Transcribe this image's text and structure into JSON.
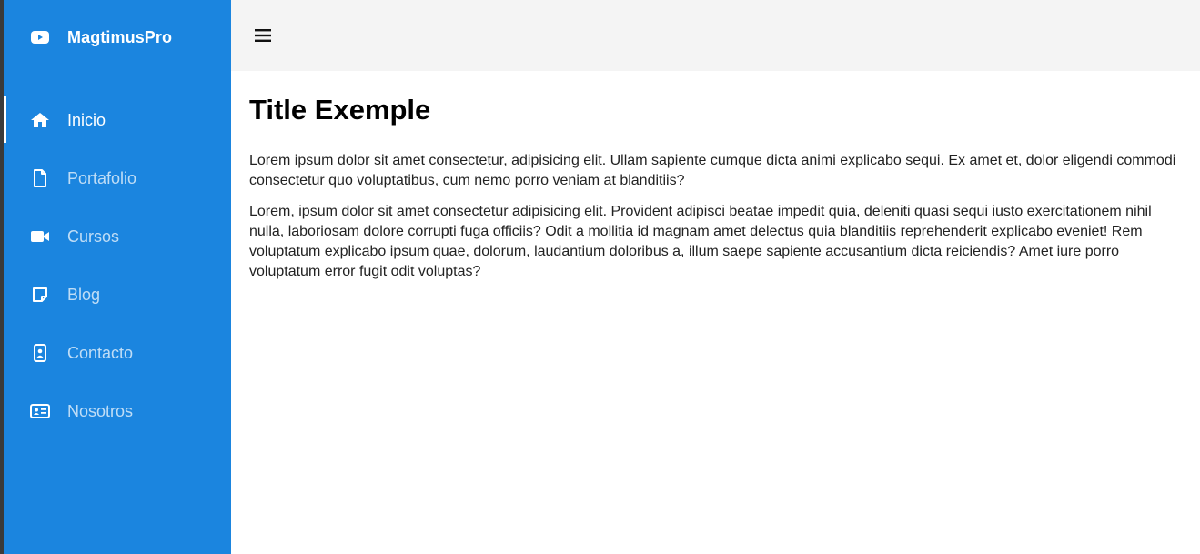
{
  "brand": {
    "name": "MagtimusPro",
    "icon": "youtube-play-icon"
  },
  "sidebar": {
    "items": [
      {
        "label": "Inicio",
        "icon": "home-icon",
        "active": true
      },
      {
        "label": "Portafolio",
        "icon": "file-icon",
        "active": false
      },
      {
        "label": "Cursos",
        "icon": "video-camera-icon",
        "active": false
      },
      {
        "label": "Blog",
        "icon": "note-icon",
        "active": false
      },
      {
        "label": "Contacto",
        "icon": "contact-card-icon",
        "active": false
      },
      {
        "label": "Nosotros",
        "icon": "id-card-icon",
        "active": false
      }
    ]
  },
  "topbar": {
    "menu_icon": "hamburger-menu-icon"
  },
  "main": {
    "title": "Title Exemple",
    "paragraphs": [
      "Lorem ipsum dolor sit amet consectetur, adipisicing elit. Ullam sapiente cumque dicta animi explicabo sequi. Ex amet et, dolor eligendi commodi consectetur quo voluptatibus, cum nemo porro veniam at blanditiis?",
      "Lorem, ipsum dolor sit amet consectetur adipisicing elit. Provident adipisci beatae impedit quia, deleniti quasi sequi iusto exercitationem nihil nulla, laboriosam dolore corrupti fuga officiis? Odit a mollitia id magnam amet delectus quia blanditiis reprehenderit explicabo eveniet! Rem voluptatum explicabo ipsum quae, dolorum, laudantium doloribus a, illum saepe sapiente accusantium dicta reiciendis? Amet iure porro voluptatum error fugit odit voluptas?"
    ]
  },
  "colors": {
    "sidebar_bg": "#1b85df",
    "topbar_bg": "#f4f4f4",
    "content_bg": "#ffffff",
    "text": "#222222"
  }
}
